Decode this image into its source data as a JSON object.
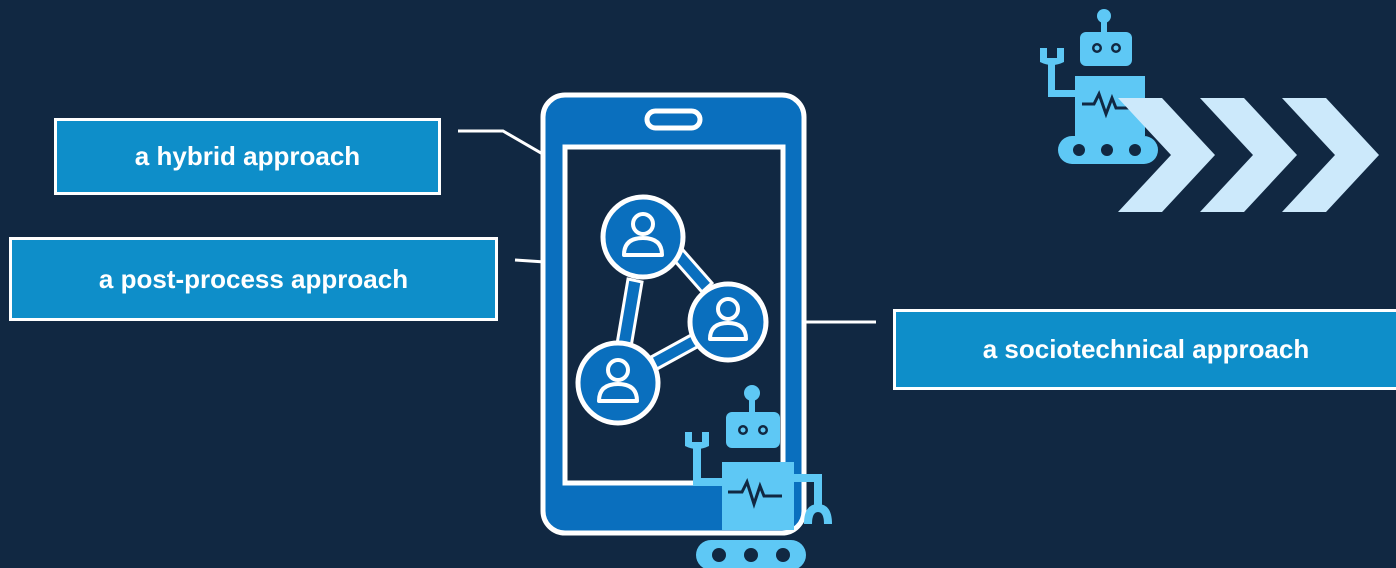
{
  "labels": {
    "hybrid": "a hybrid approach",
    "post_process": "a post-process approach",
    "sociotechnical": "a sociotechnical approach"
  },
  "colors": {
    "background": "#112842",
    "label_fill": "#0e8ec9",
    "phone_fill": "#0a6fbe",
    "robot_light": "#5ec8f5",
    "chevron": "#cce9fb",
    "outline": "#ffffff"
  },
  "icons": [
    "smartphone-icon",
    "user-network-icon",
    "robot-icon",
    "chevrons-icon"
  ]
}
